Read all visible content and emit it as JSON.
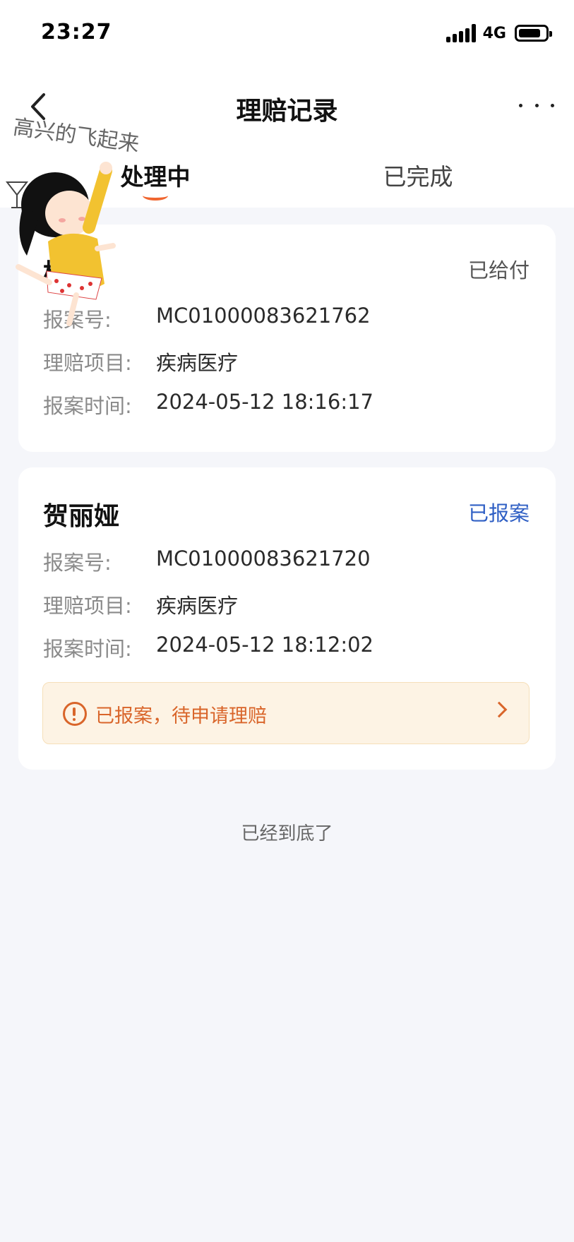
{
  "status_bar": {
    "time": "23:27",
    "network": "4G"
  },
  "nav": {
    "title": "理赔记录"
  },
  "tabs": [
    {
      "label": "处理中",
      "active": true
    },
    {
      "label": "已完成",
      "active": false
    }
  ],
  "claims": [
    {
      "name": "杨茜",
      "status": "已给付",
      "fields": [
        {
          "label": "报案号:",
          "value": "MC01000083621762"
        },
        {
          "label": "理赔项目:",
          "value": "疾病医疗"
        },
        {
          "label": "报案时间:",
          "value": "2024-05-12 18:16:17"
        }
      ]
    },
    {
      "name": "贺丽娅",
      "status": "已报案",
      "fields": [
        {
          "label": "报案号:",
          "value": "MC01000083621720"
        },
        {
          "label": "理赔项目:",
          "value": "疾病医疗"
        },
        {
          "label": "报案时间:",
          "value": "2024-05-12 18:12:02"
        }
      ],
      "notice": "已报案，待申请理赔"
    }
  ],
  "footer": {
    "end_text": "已经到底了"
  },
  "sticker": {
    "caption": "高兴的飞起来"
  },
  "colors": {
    "accent": "#f0652f",
    "status_blue": "#2f5fc4",
    "notice_text": "#d9652a",
    "notice_bg": "#fdf3e4"
  }
}
